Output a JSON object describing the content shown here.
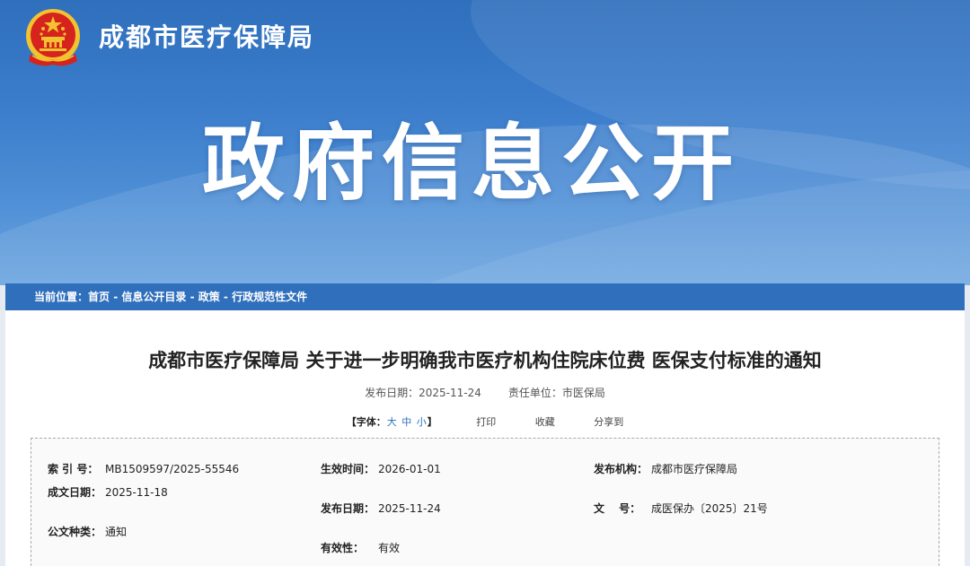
{
  "header": {
    "site_name": "成都市医疗保障局",
    "banner_title": "政府信息公开"
  },
  "breadcrumb": {
    "label": "当前位置：",
    "items": [
      "首页",
      "信息公开目录",
      "政策",
      "行政规范性文件"
    ],
    "separator": " - "
  },
  "article": {
    "title": "成都市医疗保障局 关于进一步明确我市医疗机构住院床位费 医保支付标准的通知",
    "publish_label": "发布日期：",
    "publish_date": "2025-11-24",
    "unit_label": "责任单位：",
    "unit": "市医保局"
  },
  "tools": {
    "font_label": "【字体：",
    "size_large": "大",
    "size_medium": "中",
    "size_small": "小",
    "font_close": "】",
    "print": "打印",
    "favorite": "收藏",
    "share": "分享到"
  },
  "info": {
    "index_label": "索 引 号：",
    "index_value": "MB1509597/2025-55546",
    "created_label": "成文日期：",
    "created_value": "2025-11-18",
    "doctype_label": "公文种类：",
    "doctype_value": "通知",
    "effective_label": "生效时间：",
    "effective_value": "2026-01-01",
    "publish_label": "发布日期：",
    "publish_value": "2025-11-24",
    "validity_label": "有效性：",
    "validity_value": "有效",
    "issuer_label": "发布机构：",
    "issuer_value": "成都市医疗保障局",
    "docno_label": "文　 号：",
    "docno_value": "成医保办〔2025〕21号"
  },
  "colors": {
    "primary": "#2f6fbc",
    "emblem_red": "#d6231d",
    "emblem_gold": "#f2c230"
  }
}
